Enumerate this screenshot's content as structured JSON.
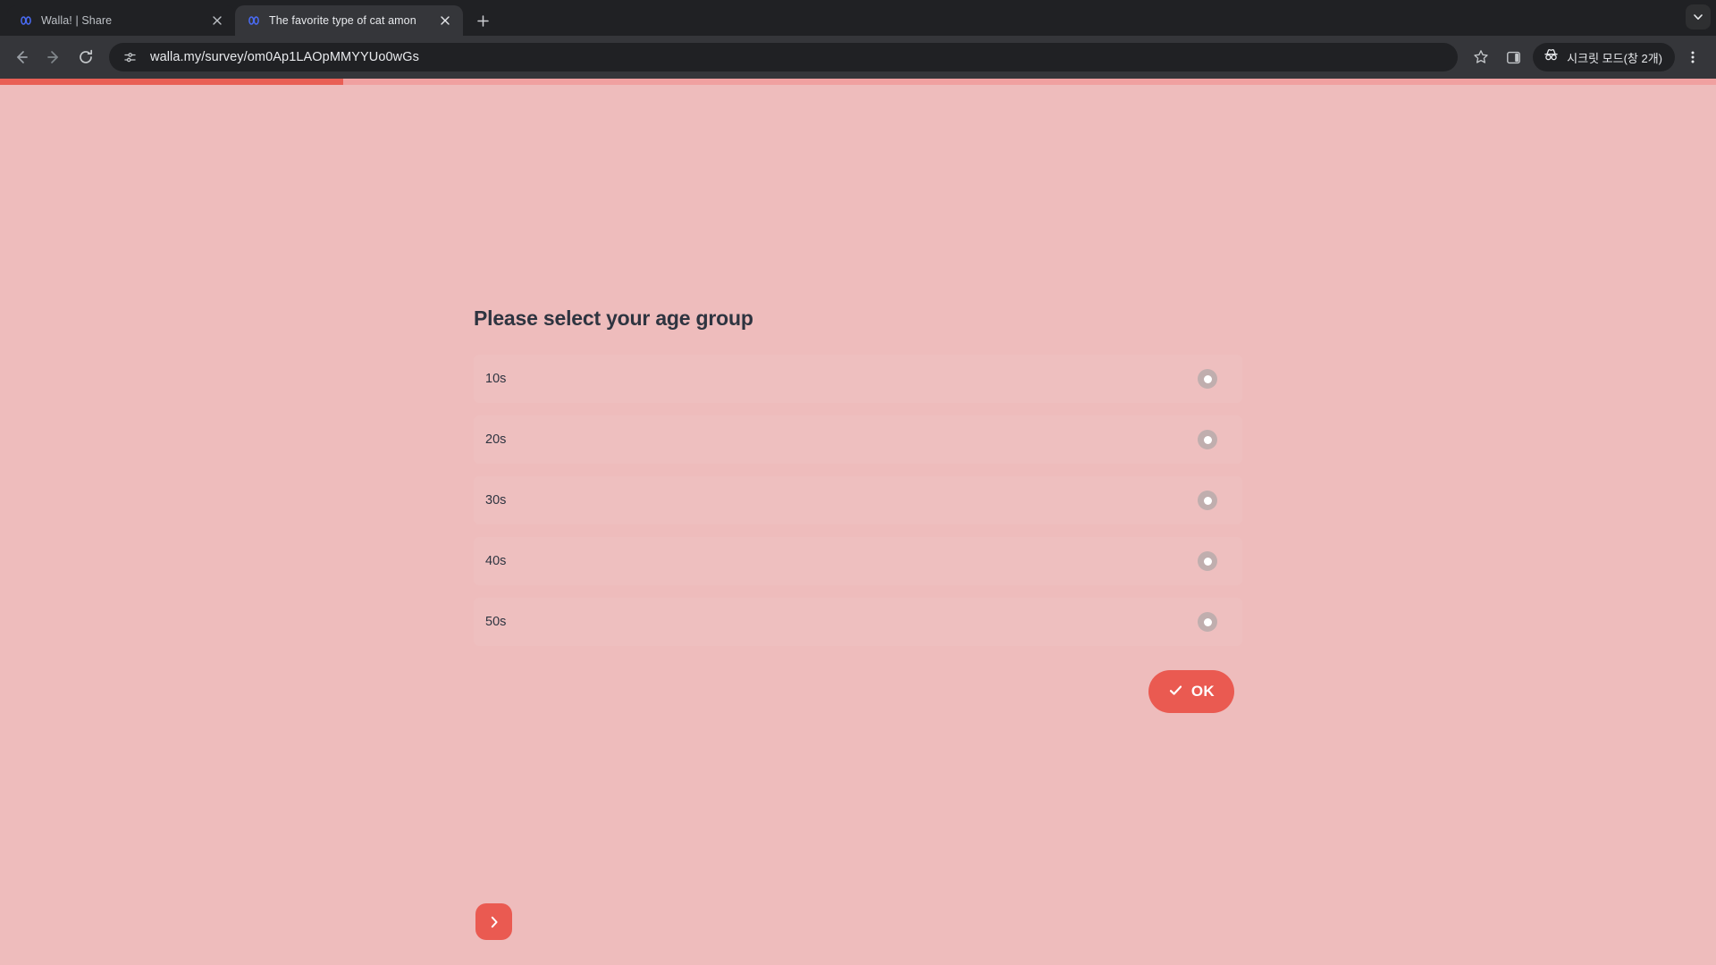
{
  "browser": {
    "tabs": [
      {
        "title": "Walla! | Share",
        "favicon": "walla-logo-icon",
        "active": false
      },
      {
        "title": "The favorite type of cat amon",
        "favicon": "walla-logo-icon",
        "active": true
      }
    ],
    "new_tab_label": "+",
    "toolbar": {
      "back_icon": "back-arrow-icon",
      "forward_icon": "forward-arrow-icon",
      "reload_icon": "reload-icon",
      "site_settings_icon": "tune-sliders-icon",
      "url": "walla.my/survey/om0Ap1LAOpMMYYUo0wGs",
      "bookmark_icon": "star-icon",
      "side_panel_icon": "side-panel-icon",
      "incognito_label": "시크릿 모드(창 2개)",
      "incognito_icon": "incognito-hat-icon",
      "menu_icon": "three-dot-menu-icon",
      "tab_search_icon": "chevron-down-icon"
    }
  },
  "page": {
    "progress_percent": 20,
    "colors": {
      "background": "#eebcbc",
      "accent": "#ea5a51",
      "progress_track": "#f0a0a0",
      "text": "#2e3440"
    },
    "title": "Please select your age group",
    "options": [
      {
        "label": "10s",
        "selected": false
      },
      {
        "label": "20s",
        "selected": false
      },
      {
        "label": "30s",
        "selected": false
      },
      {
        "label": "40s",
        "selected": false
      },
      {
        "label": "50s",
        "selected": false
      }
    ],
    "ok_button": {
      "label": "OK",
      "icon": "check-icon"
    },
    "next_button": {
      "icon": "chevron-right-icon"
    }
  }
}
